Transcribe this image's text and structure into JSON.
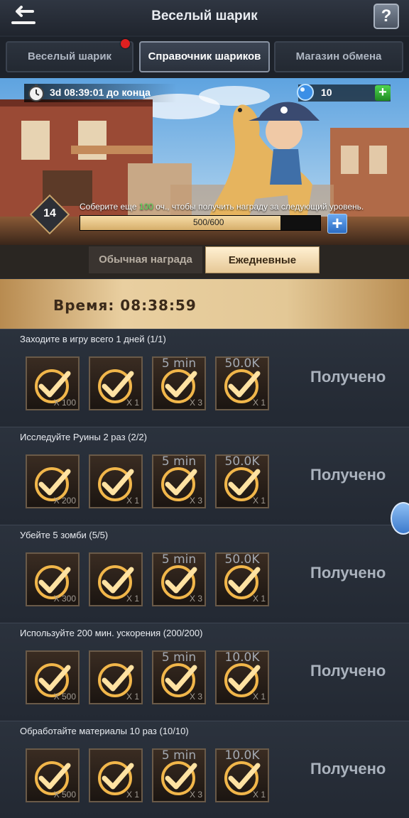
{
  "header": {
    "title": "Веселый шарик"
  },
  "tabs": [
    {
      "label": "Веселый шарик"
    },
    {
      "label": "Справочник шариков"
    },
    {
      "label": "Магазин обмена"
    }
  ],
  "banner": {
    "timer": "3d 08:39:01 до конца",
    "gems": "10",
    "level": "14",
    "progress_msg_before": "Соберите еще ",
    "progress_msg_highlight": "100",
    "progress_msg_after": " оч., чтобы получить награду за следующий уровень.",
    "progress_label": "500/600",
    "progress_current": 500,
    "progress_max": 600
  },
  "subtabs": [
    {
      "label": "Обычная награда"
    },
    {
      "label": "Ежедневные задания"
    }
  ],
  "time_band": {
    "text": "Время: 08:38:59"
  },
  "tasks": [
    {
      "title": "Заходите в игру всего 1 дней (1/1)",
      "status": "Получено",
      "rewards": [
        {
          "label": "",
          "mult": "X 100"
        },
        {
          "label": "",
          "mult": "X 1"
        },
        {
          "label": "5 min",
          "mult": "X 3"
        },
        {
          "label": "50.0K",
          "mult": "X 1"
        }
      ]
    },
    {
      "title": "Исследуйте Руины 2 раз (2/2)",
      "status": "Получено",
      "rewards": [
        {
          "label": "",
          "mult": "X 200"
        },
        {
          "label": "",
          "mult": "X 1"
        },
        {
          "label": "5 min",
          "mult": "X 3"
        },
        {
          "label": "50.0K",
          "mult": "X 1"
        }
      ]
    },
    {
      "title": "Убейте 5 зомби (5/5)",
      "status": "Получено",
      "rewards": [
        {
          "label": "",
          "mult": "X 300"
        },
        {
          "label": "",
          "mult": "X 1"
        },
        {
          "label": "5 min",
          "mult": "X 3"
        },
        {
          "label": "50.0K",
          "mult": "X 1"
        }
      ]
    },
    {
      "title": "Используйте 200 мин. ускорения (200/200)",
      "status": "Получено",
      "rewards": [
        {
          "label": "",
          "mult": "X 500"
        },
        {
          "label": "",
          "mult": "X 1"
        },
        {
          "label": "5 min",
          "mult": "X 3"
        },
        {
          "label": "10.0K",
          "mult": "X 1"
        }
      ]
    },
    {
      "title": "Обработайте материалы 10 раз (10/10)",
      "status": "Получено",
      "rewards": [
        {
          "label": "",
          "mult": "X 500"
        },
        {
          "label": "",
          "mult": "X 1"
        },
        {
          "label": "5 min",
          "mult": "X 3"
        },
        {
          "label": "10.0K",
          "mult": "X 1"
        }
      ]
    }
  ]
}
